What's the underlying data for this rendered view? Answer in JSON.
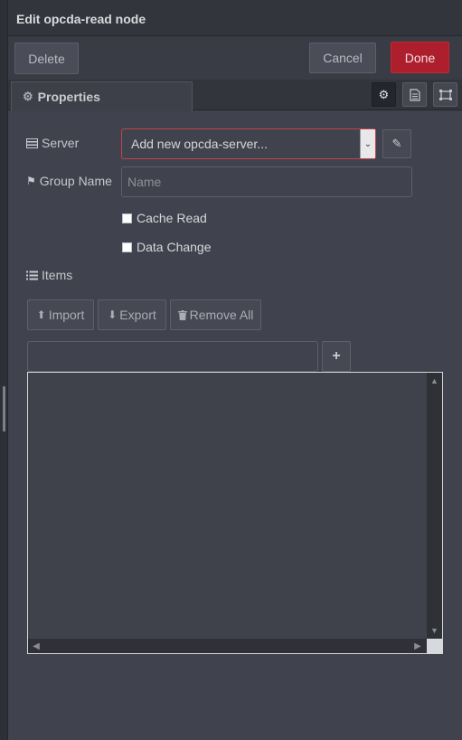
{
  "header": {
    "title": "Edit opcda-read node"
  },
  "toolbar": {
    "delete_label": "Delete",
    "cancel_label": "Cancel",
    "done_label": "Done"
  },
  "tabs": {
    "properties_label": "Properties",
    "icons": [
      "gear-icon",
      "description-icon",
      "appearance-icon"
    ]
  },
  "form": {
    "server": {
      "label": "Server",
      "selected": "Add new opcda-server..."
    },
    "group_name": {
      "label": "Group Name",
      "placeholder": "Name",
      "value": ""
    },
    "cache_read": {
      "label": "Cache Read",
      "checked": false
    },
    "data_change": {
      "label": "Data Change",
      "checked": false
    },
    "items": {
      "label": "Items",
      "import_label": "Import",
      "export_label": "Export",
      "remove_all_label": "Remove All",
      "entries": []
    }
  },
  "colors": {
    "done_button": "#ae1f2d",
    "select_border": "#c2414c",
    "background": "#40434d"
  }
}
